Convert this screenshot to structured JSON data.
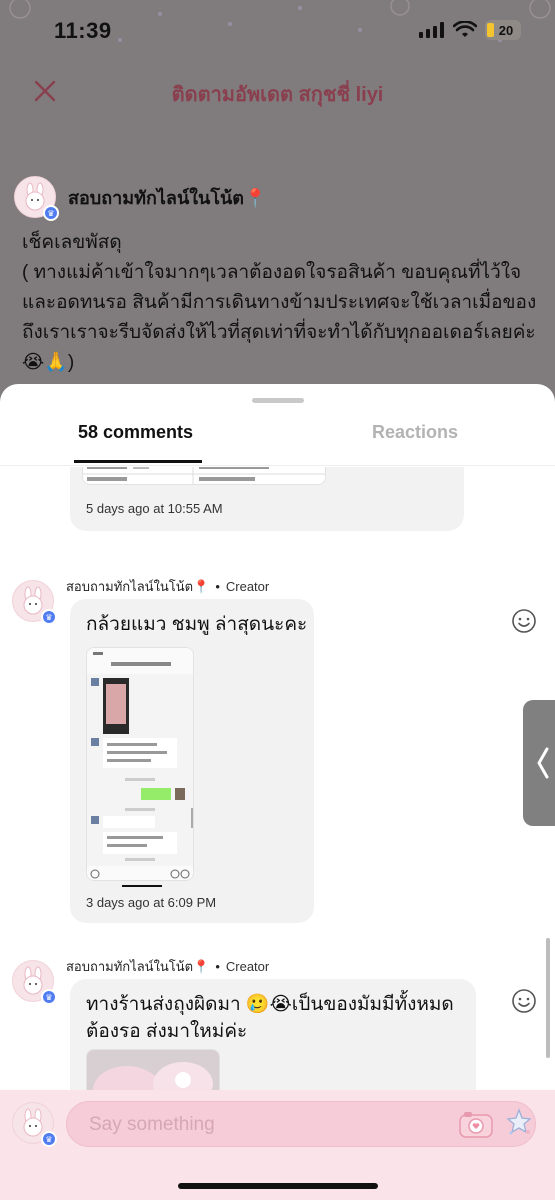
{
  "status_bar": {
    "time": "11:39",
    "battery": "20"
  },
  "header": {
    "title": "ติดตามอัพเดต สกุชชี่ liyi"
  },
  "post": {
    "author": "สอบถามทักไลน์ในโน้ต📍",
    "body": "เช็คเลขพัสดุ\n( ทางแม่ค้าเข้าใจมากๆเวลาต้องอดใจรอสินค้า ขอบคุณที่ไว้ใจและอดทนรอ สินค้ามีการเดินทางข้ามประเทศจะใช้เวลาเมื่อของถึงเราเราจะรีบจัดส่งให้ไวที่สุดเท่าที่จะทำได้กับทุกออเดอร์เลยค่ะ😭🙏)"
  },
  "sheet": {
    "tab_comments": "58 comments",
    "tab_reactions": "Reactions",
    "comments": [
      {
        "timestamp": "5 days ago at 10:55 AM"
      },
      {
        "author": "สอบถามทักไลน์ในโน้ต📍",
        "separator": "•",
        "role": "Creator",
        "text": "กล้วยแมว ชมพู ล่าสุดนะคะ",
        "timestamp": "3 days ago at 6:09 PM"
      },
      {
        "author": "สอบถามทักไลน์ในโน้ต📍",
        "separator": "•",
        "role": "Creator",
        "text": "ทางร้านส่งถุงผิดมา 🥲😭เป็นของมัมมีทั้งหมด ต้องรอ ส่งมาใหม่ค่ะ"
      }
    ]
  },
  "footer": {
    "placeholder": "Say something"
  },
  "colors": {
    "accent_title": "#8a3f4f",
    "footer_bg": "#fbe3ea",
    "input_bg": "#f6ccd8",
    "badge_blue": "#4f7cf0"
  }
}
